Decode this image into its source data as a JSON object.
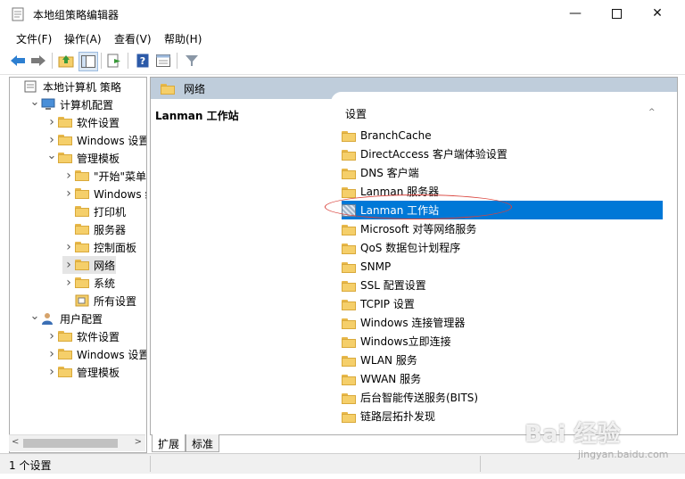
{
  "window": {
    "title": "本地组策略编辑器"
  },
  "menu": [
    "文件(F)",
    "操作(A)",
    "查看(V)",
    "帮助(H)"
  ],
  "left_tree": [
    {
      "label": "本地计算机 策略",
      "icon": "policy-icon",
      "indent": 0,
      "chev": ""
    },
    {
      "label": "计算机配置",
      "icon": "computer-icon",
      "indent": 1,
      "chev": "v"
    },
    {
      "label": "软件设置",
      "icon": "folder-icon",
      "indent": 2,
      "chev": ">"
    },
    {
      "label": "Windows 设置",
      "icon": "folder-icon",
      "indent": 2,
      "chev": ">"
    },
    {
      "label": "管理模板",
      "icon": "folder-icon",
      "indent": 2,
      "chev": "v"
    },
    {
      "label": "\"开始\"菜单和",
      "icon": "folder-icon",
      "indent": 3,
      "chev": ">"
    },
    {
      "label": "Windows 组件",
      "icon": "folder-icon",
      "indent": 3,
      "chev": ">"
    },
    {
      "label": "打印机",
      "icon": "folder-icon",
      "indent": 3,
      "chev": ""
    },
    {
      "label": "服务器",
      "icon": "folder-icon",
      "indent": 3,
      "chev": ""
    },
    {
      "label": "控制面板",
      "icon": "folder-icon",
      "indent": 3,
      "chev": ">"
    },
    {
      "label": "网络",
      "icon": "folder-icon",
      "indent": 3,
      "chev": ">",
      "selected": true
    },
    {
      "label": "系统",
      "icon": "folder-icon",
      "indent": 3,
      "chev": ">"
    },
    {
      "label": "所有设置",
      "icon": "settings-icon",
      "indent": 3,
      "chev": ""
    },
    {
      "label": "用户配置",
      "icon": "user-icon",
      "indent": 1,
      "chev": "v"
    },
    {
      "label": "软件设置",
      "icon": "folder-icon",
      "indent": 2,
      "chev": ">"
    },
    {
      "label": "Windows 设置",
      "icon": "folder-icon",
      "indent": 2,
      "chev": ">"
    },
    {
      "label": "管理模板",
      "icon": "folder-icon",
      "indent": 2,
      "chev": ">"
    }
  ],
  "right": {
    "header": "网络",
    "description_title": "Lanman 工作站",
    "list_header": "设置",
    "items": [
      {
        "label": "BranchCache"
      },
      {
        "label": "DirectAccess 客户端体验设置"
      },
      {
        "label": "DNS 客户端"
      },
      {
        "label": "Lanman 服务器"
      },
      {
        "label": "Lanman 工作站",
        "selected": true
      },
      {
        "label": "Microsoft 对等网络服务"
      },
      {
        "label": "QoS 数据包计划程序"
      },
      {
        "label": "SNMP"
      },
      {
        "label": "SSL 配置设置"
      },
      {
        "label": "TCPIP 设置"
      },
      {
        "label": "Windows 连接管理器"
      },
      {
        "label": "Windows立即连接"
      },
      {
        "label": "WLAN 服务"
      },
      {
        "label": "WWAN 服务"
      },
      {
        "label": "后台智能传送服务(BITS)"
      },
      {
        "label": "链路层拓扑发现"
      }
    ]
  },
  "tabs": [
    "扩展",
    "标准"
  ],
  "status": {
    "text": "1 个设置"
  },
  "watermark": {
    "brand": "Bai 经验",
    "url": "jingyan.baidu.com"
  },
  "colors": {
    "selection": "#0078d7",
    "header_band": "#bfcddb",
    "annotation": "#d9423b"
  }
}
